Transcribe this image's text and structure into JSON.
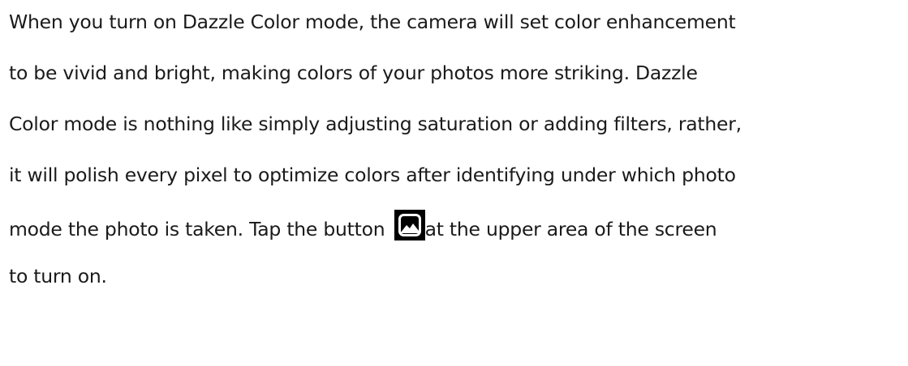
{
  "paragraph": {
    "line1": "When you turn on Dazzle Color mode, the camera will set color enhancement",
    "line2": "to be vivid and bright, making colors of your photos more striking. Dazzle",
    "line3": "Color mode is nothing like simply adjusting saturation or adding filters, rather,",
    "line4": "it will polish every pixel to optimize colors after identifying under which photo",
    "line5": "mode the photo is taken. Tap the button ",
    "line5_after_icon": "at the upper area of the screen",
    "line6": "to turn on."
  },
  "icons": {
    "inline_button_icon": "dazzle-color-image-icon"
  }
}
